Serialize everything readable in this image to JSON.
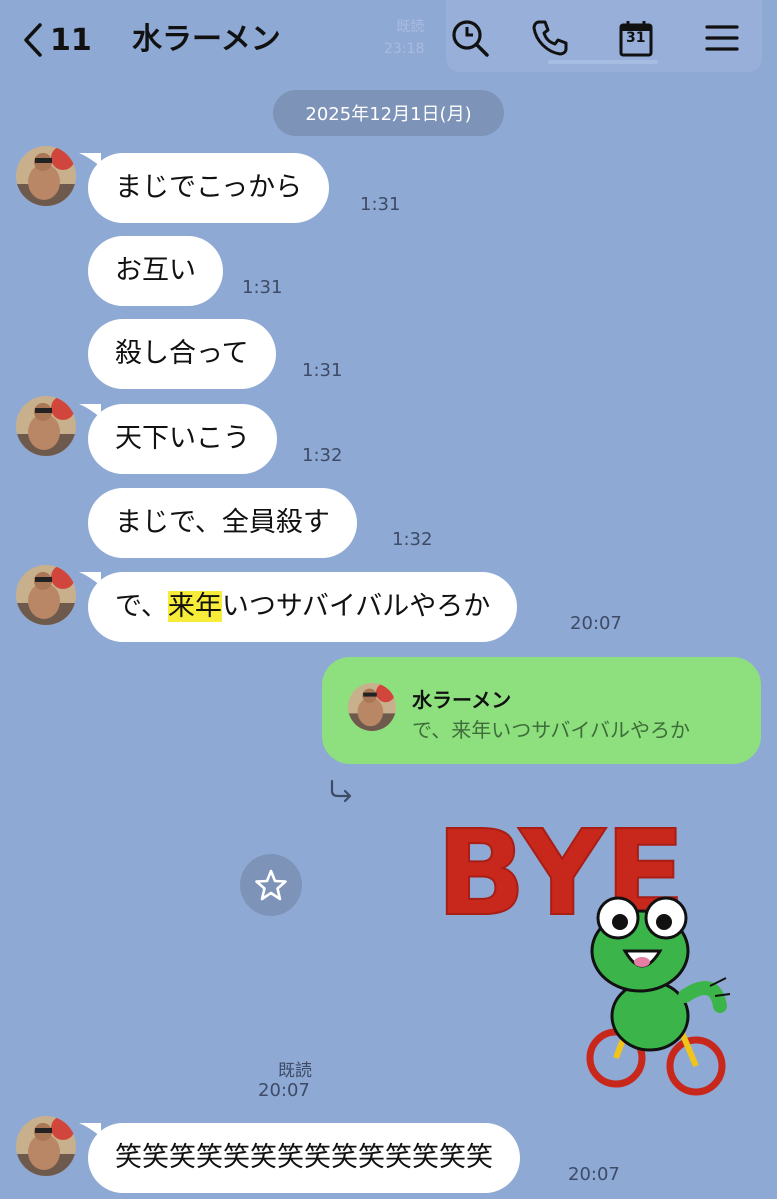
{
  "header": {
    "back_count": "11",
    "title": "水ラーメン",
    "ghost_read": "既読",
    "ghost_time": "23:18",
    "calendar_day": "31"
  },
  "date_divider": "2025年12月1日(月)",
  "messages": [
    {
      "text": "まじでこっから",
      "time": "1:31"
    },
    {
      "text": "お互い",
      "time": "1:31"
    },
    {
      "text": "殺し合って",
      "time": "1:31"
    },
    {
      "text": "天下いこう",
      "time": "1:32"
    },
    {
      "text": "まじで、全員殺す",
      "time": "1:32"
    },
    {
      "text_before": "で、",
      "text_highlight": "来年",
      "text_after": "いつサバイバルやろか",
      "time": "20:07"
    }
  ],
  "reply": {
    "quoted_name": "水ラーメン",
    "quoted_text": "で、来年いつサバイバルやろか"
  },
  "sticker": {
    "text": "BYE",
    "read_label": "既読",
    "time": "20:07"
  },
  "last_message": {
    "text": "笑笑笑笑笑笑笑笑笑笑笑笑笑笑",
    "time": "20:07"
  },
  "colors": {
    "background": "#8fa9d5",
    "incoming_bubble": "#ffffff",
    "outgoing_bubble": "#8de07d",
    "highlight": "#f8ec3a",
    "pill": "#7d93b8"
  }
}
